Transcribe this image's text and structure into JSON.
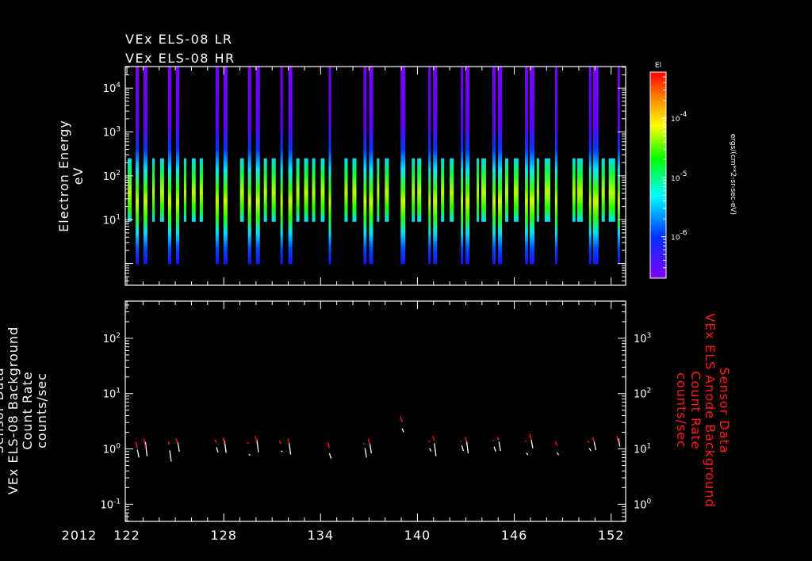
{
  "chart_data": [
    {
      "type": "heatmap",
      "title_lines": [
        "VEx ELS-08 LR",
        "VEx ELS-08 HR"
      ],
      "ylabel_lines": [
        "Electron Energy",
        "eV"
      ],
      "yscale": "log",
      "ylim": [
        0.32,
        31000
      ],
      "xlim": [
        121.9,
        152.9
      ],
      "y_ticks": [
        {
          "base": "10",
          "exp": "4",
          "value": 10000
        },
        {
          "base": "10",
          "exp": "3",
          "value": 1000
        },
        {
          "base": "10",
          "exp": "2",
          "value": 100
        },
        {
          "base": "10",
          "exp": "1",
          "value": 10
        }
      ],
      "colorbar": {
        "label": "El",
        "units": "ergs/(cm**2-sr-sec-eV)",
        "scale": "log",
        "range": [
          2e-07,
          0.0006
        ],
        "ticks": [
          {
            "base": "10",
            "exp": "-4",
            "value": 0.0001
          },
          {
            "base": "10",
            "exp": "-5",
            "value": 1e-05
          },
          {
            "base": "10",
            "exp": "-6",
            "value": 1e-06
          }
        ],
        "colors": [
          "#7f00ff",
          "#0030ff",
          "#00ffff",
          "#00ff00",
          "#ffff00",
          "#ff8000",
          "#ff0000"
        ]
      },
      "energy_ranges": {
        "wide": [
          0.97,
          31000
        ],
        "narrow": [
          9,
          250
        ]
      },
      "bars": [
        [
          122.05,
          122.29,
          "narrow"
        ],
        [
          122.54,
          122.74,
          "wide"
        ],
        [
          123.03,
          123.27,
          "wide"
        ],
        [
          123.57,
          123.72,
          "narrow"
        ],
        [
          124.06,
          124.3,
          "narrow"
        ],
        [
          124.55,
          124.75,
          "wide"
        ],
        [
          125.04,
          125.24,
          "wide"
        ],
        [
          125.53,
          125.68,
          "narrow"
        ],
        [
          126.02,
          126.26,
          "narrow"
        ],
        [
          126.51,
          126.71,
          "narrow"
        ],
        [
          127.49,
          127.69,
          "wide"
        ],
        [
          127.98,
          128.23,
          "wide"
        ],
        [
          129.01,
          129.25,
          "narrow"
        ],
        [
          129.5,
          129.7,
          "wide"
        ],
        [
          129.99,
          130.24,
          "wide"
        ],
        [
          130.48,
          130.68,
          "narrow"
        ],
        [
          130.97,
          131.22,
          "narrow"
        ],
        [
          131.51,
          131.66,
          "wide"
        ],
        [
          132.0,
          132.25,
          "wide"
        ],
        [
          132.49,
          132.69,
          "narrow"
        ],
        [
          132.98,
          133.23,
          "narrow"
        ],
        [
          133.47,
          133.67,
          "narrow"
        ],
        [
          134.01,
          134.25,
          "narrow"
        ],
        [
          134.5,
          134.65,
          "wide"
        ],
        [
          135.48,
          135.68,
          "narrow"
        ],
        [
          135.97,
          136.22,
          "narrow"
        ],
        [
          136.66,
          136.85,
          "wide"
        ],
        [
          137.0,
          137.25,
          "wide"
        ],
        [
          137.49,
          137.64,
          "narrow"
        ],
        [
          137.98,
          138.23,
          "narrow"
        ],
        [
          138.96,
          139.25,
          "wide"
        ],
        [
          139.65,
          139.84,
          "narrow"
        ],
        [
          139.99,
          140.24,
          "narrow"
        ],
        [
          140.68,
          140.82,
          "wide"
        ],
        [
          140.97,
          141.22,
          "wide"
        ],
        [
          141.46,
          141.66,
          "narrow"
        ],
        [
          142.0,
          142.25,
          "narrow"
        ],
        [
          142.69,
          142.83,
          "wide"
        ],
        [
          142.98,
          143.23,
          "wide"
        ],
        [
          143.67,
          143.81,
          "narrow"
        ],
        [
          143.96,
          144.25,
          "narrow"
        ],
        [
          144.65,
          144.84,
          "wide"
        ],
        [
          144.99,
          145.24,
          "wide"
        ],
        [
          145.43,
          145.63,
          "narrow"
        ],
        [
          145.97,
          146.26,
          "narrow"
        ],
        [
          146.66,
          146.85,
          "wide"
        ],
        [
          146.95,
          147.25,
          "wide"
        ],
        [
          147.39,
          147.54,
          "narrow"
        ],
        [
          147.88,
          148.23,
          "narrow"
        ],
        [
          148.52,
          148.67,
          "wide"
        ],
        [
          149.6,
          149.79,
          "narrow"
        ],
        [
          149.89,
          150.24,
          "narrow"
        ],
        [
          150.63,
          150.77,
          "wide"
        ],
        [
          150.87,
          151.22,
          "wide"
        ],
        [
          151.41,
          151.61,
          "narrow"
        ],
        [
          151.85,
          152.25,
          "narrow"
        ],
        [
          152.4,
          152.55,
          "wide"
        ]
      ]
    },
    {
      "type": "scatter",
      "ylabel_lines": [
        "Sensor Data",
        "VEx ELS-08 Background",
        "Count Rate",
        "counts/sec"
      ],
      "ylabel_right_lines": [
        "Sensor Data",
        "VEx ELS Anode Background",
        "Count Rate",
        "counts/sec"
      ],
      "yscale": "log",
      "ylim": [
        0.049,
        470
      ],
      "ylim_right": [
        0.49,
        4700
      ],
      "y_ticks": [
        {
          "base": "10",
          "exp": "2",
          "value": 100
        },
        {
          "base": "10",
          "exp": "1",
          "value": 10
        },
        {
          "base": "10",
          "exp": "0",
          "value": 1
        },
        {
          "base": "10",
          "exp": "-1",
          "value": 0.1
        }
      ],
      "y_ticks_right": [
        {
          "base": "10",
          "exp": "3",
          "value": 1000
        },
        {
          "base": "10",
          "exp": "2",
          "value": 100
        },
        {
          "base": "10",
          "exp": "1",
          "value": 10
        },
        {
          "base": "10",
          "exp": "0",
          "value": 1
        }
      ],
      "year_label": "2012",
      "x_ticks": [
        {
          "label": "122",
          "value": 122
        },
        {
          "label": "128",
          "value": 128
        },
        {
          "label": "134",
          "value": 134
        },
        {
          "label": "140",
          "value": 140
        },
        {
          "label": "146",
          "value": 146
        },
        {
          "label": "152",
          "value": 152
        }
      ],
      "series": [
        {
          "name": "VEx ELS-08 Background",
          "axis": "left",
          "color": "#ffffff",
          "points": [
            [
              122.6,
              0.7,
              0.97
            ],
            [
              123.1,
              0.74,
              1.34
            ],
            [
              124.6,
              0.59,
              0.94
            ],
            [
              125.1,
              0.89,
              1.34
            ],
            [
              127.5,
              0.87,
              1.07
            ],
            [
              128.0,
              0.85,
              1.4
            ],
            [
              129.5,
              0.77,
              0.8
            ],
            [
              130.0,
              0.87,
              1.47
            ],
            [
              131.5,
              0.89,
              0.92
            ],
            [
              132.0,
              0.79,
              1.27
            ],
            [
              134.5,
              0.67,
              0.83
            ],
            [
              136.7,
              0.7,
              1.03
            ],
            [
              137.0,
              0.83,
              1.27
            ],
            [
              139.0,
              2.0,
              2.35
            ],
            [
              140.7,
              0.9,
              1.03
            ],
            [
              141.0,
              0.74,
              1.27
            ],
            [
              142.7,
              0.92,
              1.15
            ],
            [
              143.0,
              0.83,
              1.35
            ],
            [
              144.7,
              0.89,
              1.1
            ],
            [
              145.0,
              0.92,
              1.35
            ],
            [
              146.7,
              0.78,
              0.85
            ],
            [
              147.0,
              1.03,
              1.48
            ],
            [
              148.6,
              0.78,
              0.86
            ],
            [
              150.6,
              0.92,
              1.03
            ],
            [
              150.9,
              0.95,
              1.35
            ],
            [
              152.4,
              1.1,
              1.55
            ]
          ]
        },
        {
          "name": "VEx ELS Anode Background",
          "axis": "right",
          "color": "#ff1a1a",
          "points": [
            [
              122.6,
              10.3,
              13.4
            ],
            [
              123.1,
              11.0,
              15.3
            ],
            [
              124.6,
              12.0,
              13.4
            ],
            [
              125.1,
              12.4,
              15.3
            ],
            [
              127.5,
              13.0,
              14.7
            ],
            [
              128.0,
              12.4,
              16.0
            ],
            [
              129.5,
              12.4,
              13.3
            ],
            [
              130.0,
              13.5,
              17.0
            ],
            [
              131.5,
              12.4,
              14.0
            ],
            [
              132.0,
              13.0,
              15.3
            ],
            [
              134.5,
              10.3,
              13.0
            ],
            [
              136.7,
              12.0,
              12.6
            ],
            [
              137.0,
              12.0,
              15.3
            ],
            [
              139.0,
              30.6,
              38.5
            ],
            [
              140.7,
              13.5,
              14.0
            ],
            [
              141.0,
              14.0,
              17.0
            ],
            [
              142.7,
              13.5,
              14.0
            ],
            [
              143.0,
              13.5,
              16.4
            ],
            [
              144.7,
              14.0,
              14.5
            ],
            [
              145.0,
              14.3,
              16.4
            ],
            [
              146.7,
              13.5,
              14.0
            ],
            [
              147.0,
              14.3,
              19.0
            ],
            [
              148.6,
              11.3,
              13.8
            ],
            [
              150.6,
              13.0,
              13.8
            ],
            [
              150.9,
              13.5,
              16.4
            ],
            [
              152.4,
              13.5,
              17.0
            ]
          ]
        }
      ]
    }
  ]
}
